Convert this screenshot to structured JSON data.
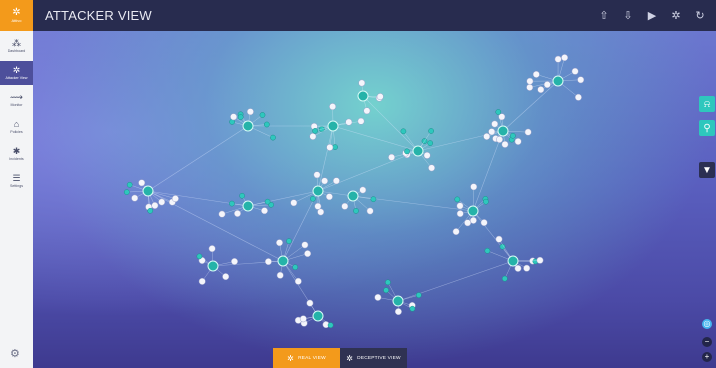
{
  "brand": {
    "name": "Attivo",
    "color": "#f39a1b"
  },
  "sidebar": {
    "items": [
      {
        "label": "Dashboard",
        "icon": "dashboard-icon",
        "glyph": "⁂",
        "active": false
      },
      {
        "label": "Attacker View",
        "icon": "attacker-view-icon",
        "glyph": "✲",
        "active": true
      },
      {
        "label": "Monitor",
        "icon": "monitor-icon",
        "glyph": "⟿",
        "active": false
      },
      {
        "label": "Policies",
        "icon": "policies-icon",
        "glyph": "⌂",
        "active": false
      },
      {
        "label": "Incidents",
        "icon": "incidents-icon",
        "glyph": "✱",
        "active": false
      },
      {
        "label": "Settings",
        "icon": "settings-icon",
        "glyph": "☰",
        "active": false
      }
    ],
    "gear_glyph": "⚙"
  },
  "header": {
    "title": "ATTACKER VIEW",
    "actions": [
      {
        "name": "upload-icon",
        "glyph": "⇧"
      },
      {
        "name": "download-icon",
        "glyph": "⇩"
      },
      {
        "name": "play-icon",
        "glyph": "▶"
      },
      {
        "name": "network-icon",
        "glyph": "✲"
      },
      {
        "name": "refresh-icon",
        "glyph": "↻"
      }
    ]
  },
  "right_tools": [
    {
      "name": "alert-bell-icon",
      "glyph": "⍾"
    },
    {
      "name": "pin-tool-icon",
      "glyph": "⚲"
    },
    {
      "name": "filter-icon",
      "glyph": "▼"
    }
  ],
  "zoom": [
    {
      "name": "locate-icon",
      "glyph": "◎"
    },
    {
      "name": "zoom-out-icon",
      "glyph": "−"
    },
    {
      "name": "zoom-in-icon",
      "glyph": "+"
    }
  ],
  "view_toggle": {
    "real": {
      "label": "REAL VIEW",
      "glyph": "✲"
    },
    "deceptive": {
      "label": "DECEPTIVE VIEW",
      "glyph": "✲"
    }
  },
  "colors": {
    "header_bg": "#282c4f",
    "accent_teal": "#2ec7bd",
    "node_white": "#f4f5fb",
    "active_nav": "#4d4f9b"
  }
}
